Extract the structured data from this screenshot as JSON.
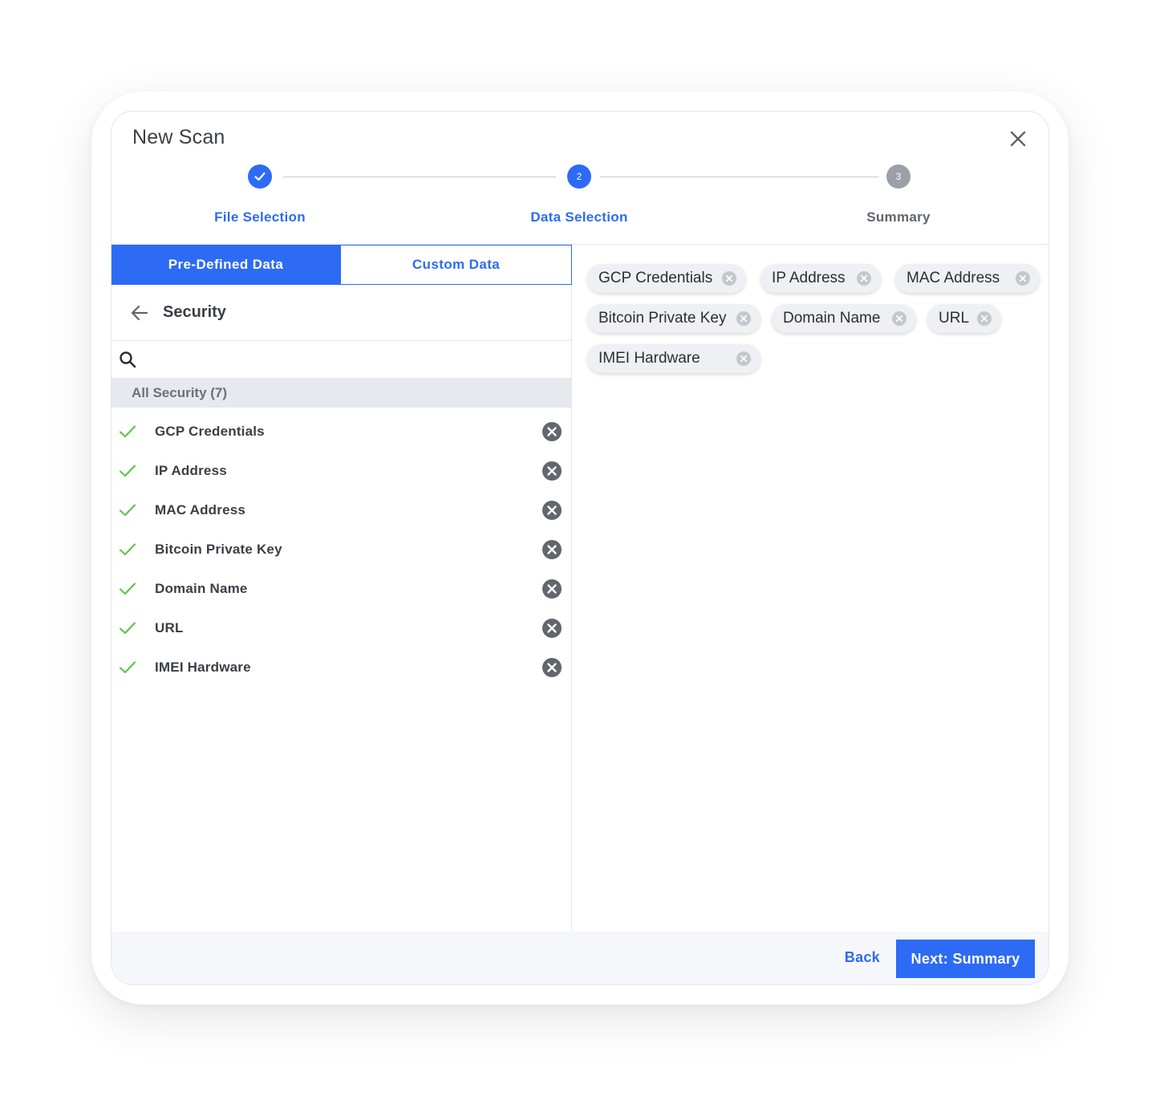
{
  "window": {
    "title": "New Scan"
  },
  "icons": {
    "close": "close-icon",
    "check": "check-icon",
    "back": "arrow-left-icon",
    "search": "search-icon",
    "remove": "remove-circle-icon"
  },
  "colors": {
    "accent": "#2d6bf4",
    "check_green": "#5cc648",
    "pending_grey": "#9ba0a7"
  },
  "stepper": {
    "steps": [
      {
        "label": "File Selection",
        "number": "1",
        "state": "done"
      },
      {
        "label": "Data Selection",
        "number": "2",
        "state": "active"
      },
      {
        "label": "Summary",
        "number": "3",
        "state": "pending"
      }
    ]
  },
  "tabs": {
    "predefined": "Pre-Defined Data",
    "custom": "Custom Data",
    "selected": "Pre-Defined Data"
  },
  "category": {
    "title": "Security"
  },
  "search": {
    "value": "",
    "placeholder": ""
  },
  "group": {
    "header": "All Security (7)"
  },
  "items": [
    {
      "label": "GCP Credentials"
    },
    {
      "label": "IP Address"
    },
    {
      "label": "MAC Address"
    },
    {
      "label": "Bitcoin Private Key"
    },
    {
      "label": "Domain Name"
    },
    {
      "label": "URL"
    },
    {
      "label": "IMEI Hardware"
    }
  ],
  "chips": [
    {
      "label": "GCP Credentials"
    },
    {
      "label": "IP Address"
    },
    {
      "label": "MAC Address"
    },
    {
      "label": "Bitcoin Private Key"
    },
    {
      "label": "Domain Name"
    },
    {
      "label": "URL"
    },
    {
      "label": "IMEI Hardware"
    }
  ],
  "footer": {
    "back": "Back",
    "next": "Next: Summary"
  }
}
